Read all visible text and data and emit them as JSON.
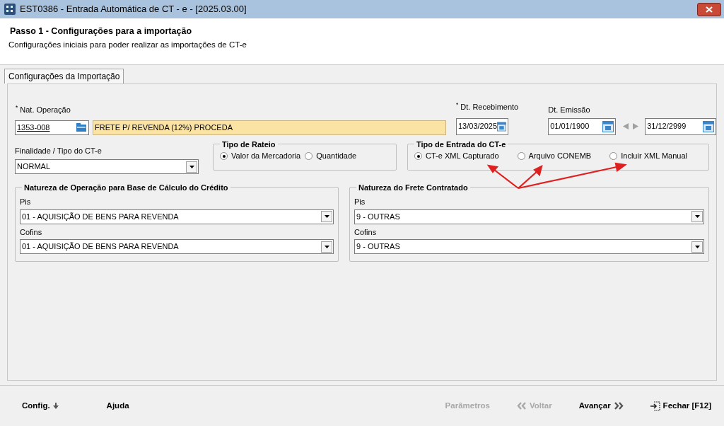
{
  "window": {
    "title": "EST0386 - Entrada Automática de CT - e - [2025.03.00]"
  },
  "header": {
    "title": "Passo 1 - Configurações para a importação",
    "subtitle": "Configurações iniciais para poder realizar as importações de CT-e"
  },
  "tabs": [
    {
      "label": "Configurações da Importação",
      "selected": true
    }
  ],
  "nat_operacao": {
    "label": "$^{*}$ Nat. Operação",
    "code": "1353-008",
    "description": "FRETE P/ REVENDA (12%) PROCEDA"
  },
  "dt_recebimento": {
    "label": "$^{*}$ Dt. Recebimento",
    "value": "13/03/2025"
  },
  "dt_emissao": {
    "label": "Dt. Emissão",
    "from": "01/01/1900",
    "to": "31/12/2999"
  },
  "finalidade": {
    "label": "Finalidade / Tipo do CT-e",
    "value": "NORMAL"
  },
  "radio_groups": [
    {
      "title": "Tipo de Rateio",
      "options": [
        {
          "label": "Valor da Mercadoria",
          "selected": true
        },
        {
          "label": "Quantidade",
          "selected": false
        }
      ]
    },
    {
      "title": "Tipo de Entrada do CT-e",
      "options": [
        {
          "label": "CT-e XML Capturado",
          "selected": true
        },
        {
          "label": "Arquivo CONEMB",
          "selected": false
        },
        {
          "label": "Incluir XML Manual",
          "selected": false
        }
      ]
    }
  ],
  "natureza_groups": [
    {
      "title": "Natureza de Operação para Base de Cálculo do Crédito",
      "fields": [
        {
          "label": "Pis",
          "value": "01 - AQUISIÇÃO DE BENS PARA REVENDA"
        },
        {
          "label": "Cofins",
          "value": "01 - AQUISIÇÃO DE BENS PARA REVENDA"
        }
      ]
    },
    {
      "title": "Natureza do Frete Contratado",
      "fields": [
        {
          "label": "Pis",
          "value": "9 - OUTRAS"
        },
        {
          "label": "Cofins",
          "value": "9 - OUTRAS"
        }
      ]
    }
  ],
  "footer": {
    "left_buttons": [
      {
        "label": "Config.",
        "disabled": false
      },
      {
        "label": "Ajuda",
        "disabled": false
      }
    ],
    "right_buttons": [
      {
        "label": "Parâmetros",
        "disabled": true
      },
      {
        "label": "Voltar",
        "disabled": true
      },
      {
        "label": "Avançar",
        "disabled": false
      },
      {
        "label": "Fechar [F12]",
        "disabled": false
      }
    ]
  }
}
